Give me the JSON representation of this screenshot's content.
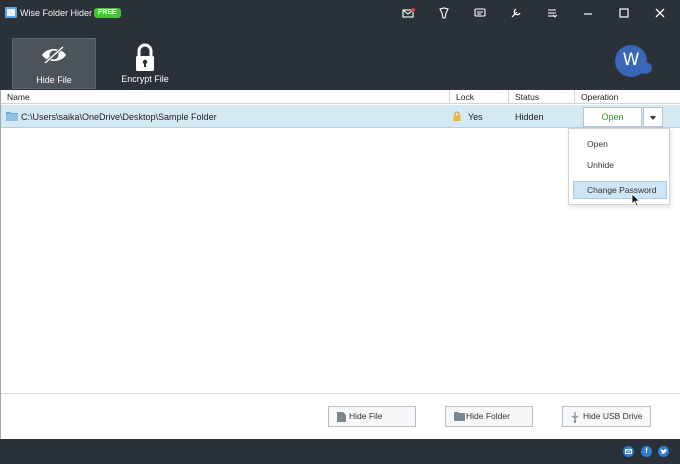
{
  "app": {
    "title": "Wise Folder Hider",
    "badge": "FREE"
  },
  "window_controls": [
    "message-icon",
    "skin-icon",
    "feedback-icon",
    "settings-icon",
    "menu-icon",
    "minimize-icon",
    "maximize-icon",
    "close-icon"
  ],
  "toolbar": {
    "tools": [
      {
        "label": "Hide File",
        "icon": "hidden-eye-icon",
        "active": true
      },
      {
        "label": "Encrypt File",
        "icon": "padlock-icon",
        "active": false
      }
    ],
    "avatar_letter": "W"
  },
  "table": {
    "columns": [
      "Name",
      "Lock",
      "Status",
      "Operation"
    ],
    "rows": [
      {
        "name": "C:\\Users\\saika\\OneDrive\\Desktop\\Sample Folder",
        "lock": "Yes",
        "status": "Hidden",
        "operation": "Open"
      }
    ]
  },
  "operation_menu": {
    "items": [
      "Open",
      "Unhide",
      "Change Password"
    ],
    "highlighted": "Change Password"
  },
  "bottom_buttons": [
    {
      "label": "Hide File",
      "icon": "file-icon"
    },
    {
      "label": "Hide Folder",
      "icon": "folder-icon"
    },
    {
      "label": "Hide USB Drive",
      "icon": "usb-icon"
    }
  ],
  "footer_social": [
    "email-icon",
    "facebook-icon",
    "twitter-icon"
  ],
  "colors": {
    "chrome": "#2b3138",
    "selected_row": "#d5e9f3",
    "open_green": "#2e9b33",
    "badge_green": "#4cc23c",
    "avatar_blue": "#3a66b8"
  }
}
